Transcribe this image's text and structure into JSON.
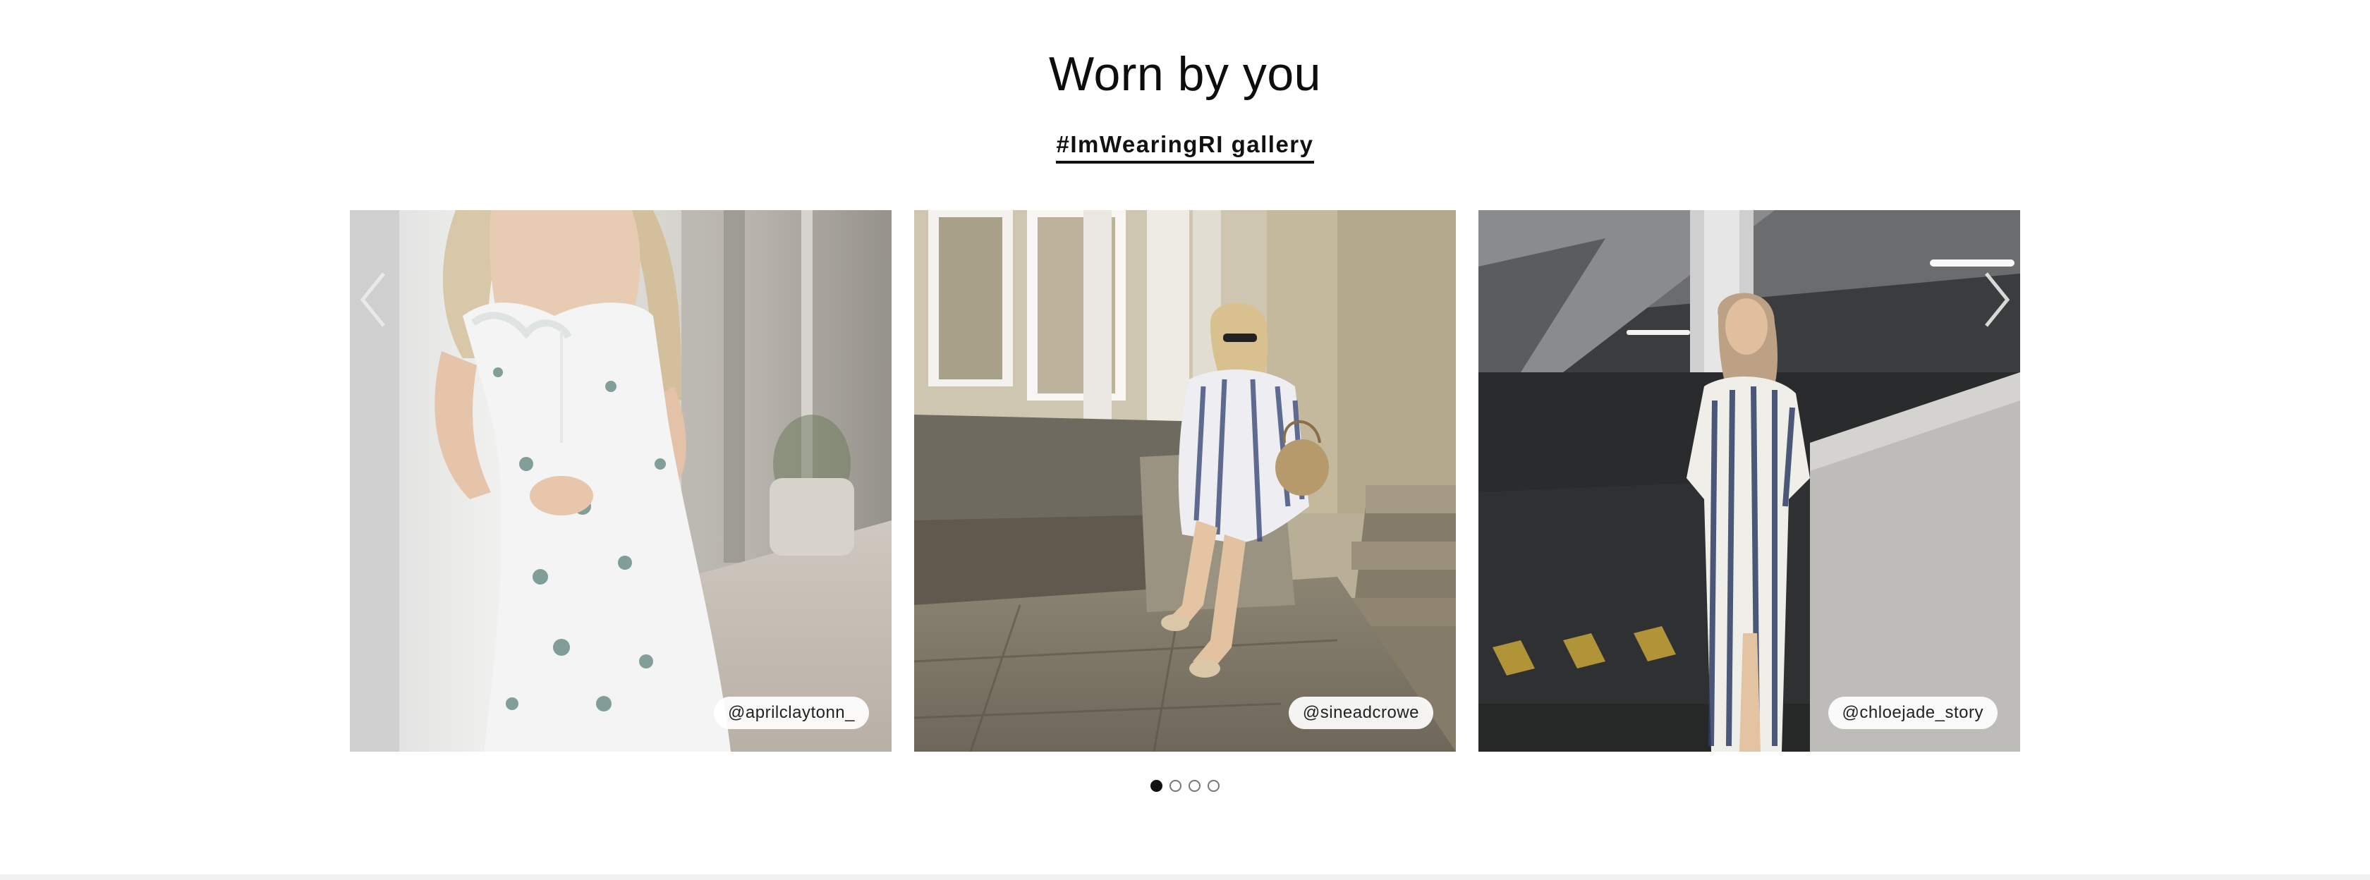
{
  "section": {
    "title": "Worn by you",
    "gallery_link": "#ImWearingRI gallery"
  },
  "carousel": {
    "items": [
      {
        "handle": "@aprilclaytonn_",
        "image": "woman in white floral sundress leaning on white wall"
      },
      {
        "handle": "@sineadcrowe",
        "image": "woman in navy tie-dye dress sitting on stone steps with straw bag"
      },
      {
        "handle": "@chloejade_story",
        "image": "woman in navy tie-dye maxi dress in car park"
      }
    ],
    "prev_icon": "chevron-left-icon",
    "next_icon": "chevron-right-icon",
    "pagination": {
      "count": 4,
      "active_index": 0
    }
  },
  "colors": {
    "text": "#111111",
    "dot_active": "#111111",
    "dot_inactive_border": "#777777"
  }
}
